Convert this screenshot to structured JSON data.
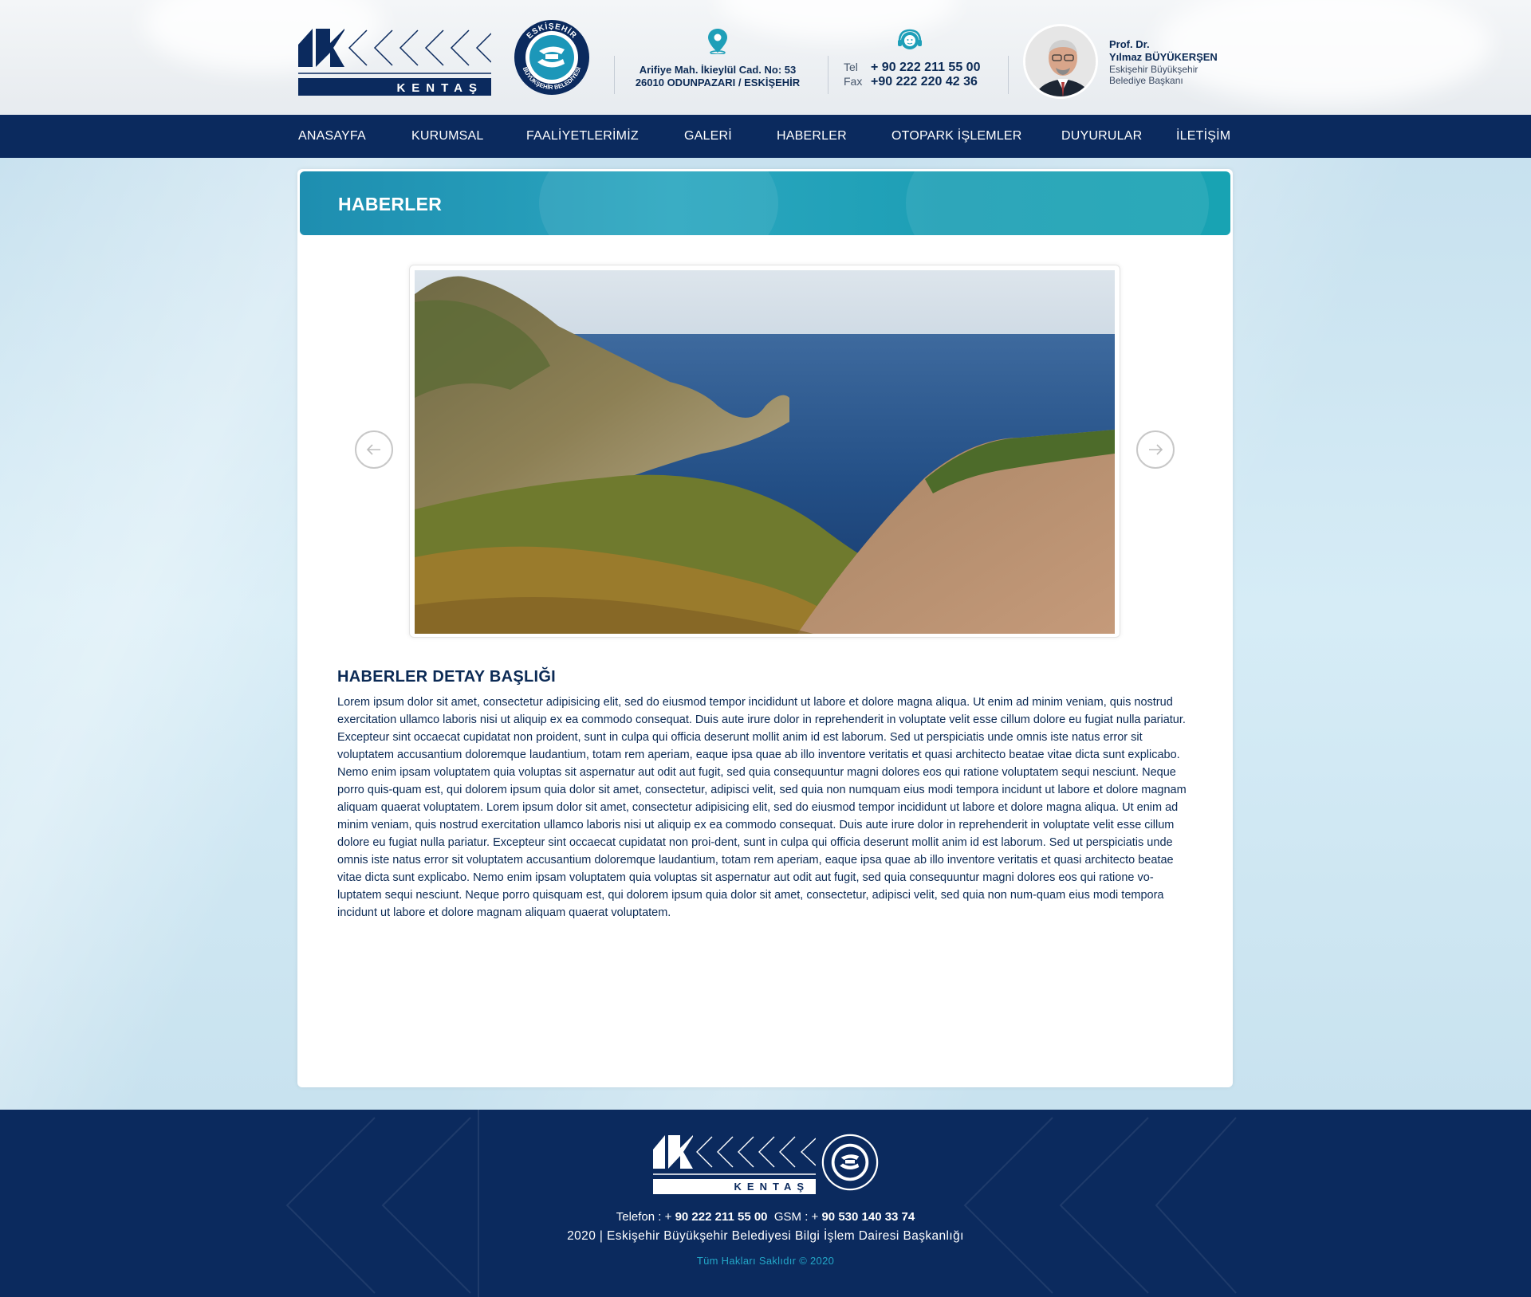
{
  "header": {
    "logo_text": "KENTAŞ",
    "seal_text_top": "ESKİŞEHİR",
    "seal_text_bottom": "BÜYÜKŞEHİR BELEDİYESİ",
    "address_line1": "Arifiye Mah. İkieylül Cad. No: 53",
    "address_line2": "26010 ODUNPAZARI / ESKİŞEHİR",
    "tel_label": "Tel",
    "tel_value": "+ 90 222 211 55 00",
    "fax_label": "Fax",
    "fax_value": "+90 222 220 42 36",
    "mayor_title": "Prof. Dr.",
    "mayor_name": "Yılmaz BÜYÜKERŞEN",
    "mayor_role_line1": "Eskişehir Büyükşehir",
    "mayor_role_line2": "Belediye Başkanı"
  },
  "nav": {
    "items": [
      {
        "label": "ANASAYFA"
      },
      {
        "label": "KURUMSAL"
      },
      {
        "label": "FAALİYETLERİMİZ"
      },
      {
        "label": "GALERİ"
      },
      {
        "label": "HABERLER"
      },
      {
        "label": "OTOPARK İŞLEMLER"
      },
      {
        "label": "DUYURULAR"
      },
      {
        "label": "İLETİŞİM"
      }
    ]
  },
  "page": {
    "banner_title": "HABERLER",
    "article_title": "HABERLER DETAY BAŞLIĞI",
    "article_body": "Lorem ipsum dolor sit amet, consectetur adipisicing elit, sed do eiusmod tempor incididunt ut labore et dolore magna aliqua. Ut enim ad minim veniam, quis nostrud exercitation ullamco laboris nisi ut aliquip ex ea commodo consequat. Duis aute irure dolor in reprehenderit in voluptate velit esse cillum dolore eu fugiat nulla pariatur. Excepteur sint occaecat cupidatat non proident, sunt in culpa qui officia deserunt mollit anim id est laborum. Sed ut perspiciatis unde omnis iste natus error sit voluptatem accusantium doloremque laudantium, totam rem aperiam, eaque ipsa quae ab illo inventore veritatis et quasi architecto beatae vitae dicta sunt explicabo. Nemo enim ipsam voluptatem quia voluptas sit aspernatur aut odit aut fugit, sed quia consequuntur magni dolores eos qui ratione voluptatem sequi nesciunt. Neque porro quis-quam est, qui dolorem ipsum quia dolor sit amet, consectetur, adipisci velit, sed quia non numquam eius modi tempora incidunt ut labore et dolore magnam aliquam quaerat voluptatem. Lorem ipsum dolor sit amet, consectetur adipisicing elit, sed do eiusmod tempor incididunt ut labore et dolore magna aliqua. Ut enim ad minim veniam, quis nostrud exercitation ullamco laboris nisi ut aliquip ex ea commodo consequat. Duis aute irure dolor in reprehenderit in voluptate velit esse cillum dolore eu fugiat nulla pariatur. Excepteur sint occaecat cupidatat non proi-dent, sunt in culpa qui officia deserunt mollit anim id est laborum. Sed ut perspiciatis unde omnis iste natus error sit voluptatem accusantium doloremque laudantium, totam rem aperiam, eaque ipsa quae ab illo inventore veritatis et quasi architecto beatae vitae dicta sunt explicabo. Nemo enim ipsam voluptatem quia voluptas sit aspernatur aut odit aut fugit, sed quia consequuntur magni dolores eos qui ratione vo-luptatem sequi nesciunt. Neque porro quisquam est, qui dolorem ipsum quia dolor sit amet, consectetur, adipisci velit, sed quia non num-quam eius modi tempora incidunt ut labore et dolore magnam aliquam quaerat voluptatem."
  },
  "footer": {
    "phone_label": "Telefon : + ",
    "phone_value": "90 222 211 55 00",
    "gsm_label": "GSM : + ",
    "gsm_value": "90 530 140 33 74",
    "copyright_line": "2020 | Eskişehir Büyükşehir Belediyesi Bilgi İşlem Dairesi Başkanlığı",
    "rights": "Tüm Hakları Saklıdır © 2020"
  },
  "colors": {
    "navy": "#0b2a5e",
    "accent_teal": "#1e9fb8",
    "footer_link": "#23a6c7"
  },
  "icons": {
    "location": "map-pin-icon",
    "support": "headset-icon",
    "prev": "arrow-left-icon",
    "next": "arrow-right-icon"
  }
}
